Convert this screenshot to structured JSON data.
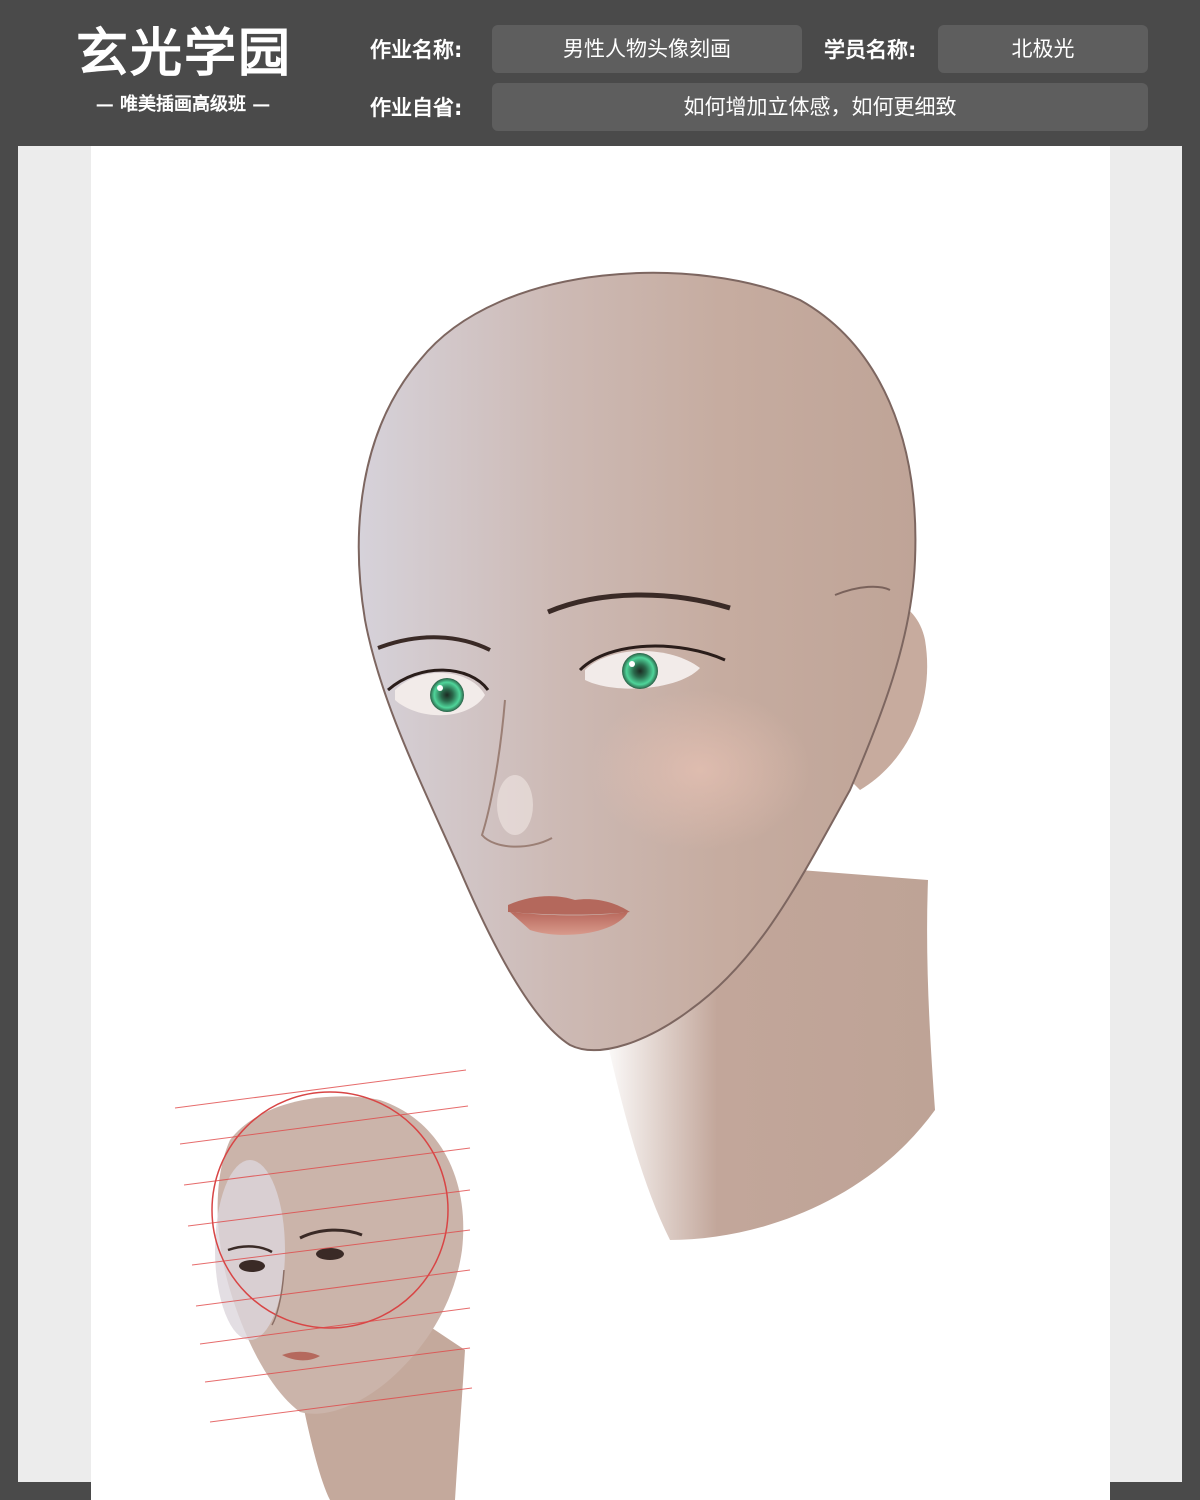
{
  "logo": {
    "title": "玄光学园",
    "subtitle": "— 唯美插画高级班 —"
  },
  "header": {
    "assignment_name_label": "作业名称:",
    "assignment_name_value": "男性人物头像刻画",
    "student_name_label": "学员名称:",
    "student_name_value": "北极光",
    "self_review_label": "作业自省:",
    "self_review_value": "如何增加立体感，如何更细致"
  },
  "colors": {
    "frame": "#4a4a4a",
    "field": "#5e5e5e",
    "canvas": "#ececec",
    "skin": "#c4a99c",
    "iris": "#3fbf8a",
    "guide_lines": "#e04848"
  },
  "artwork": {
    "main": "male-head-portrait-painting",
    "reference": "proportion-guide-sketch"
  }
}
